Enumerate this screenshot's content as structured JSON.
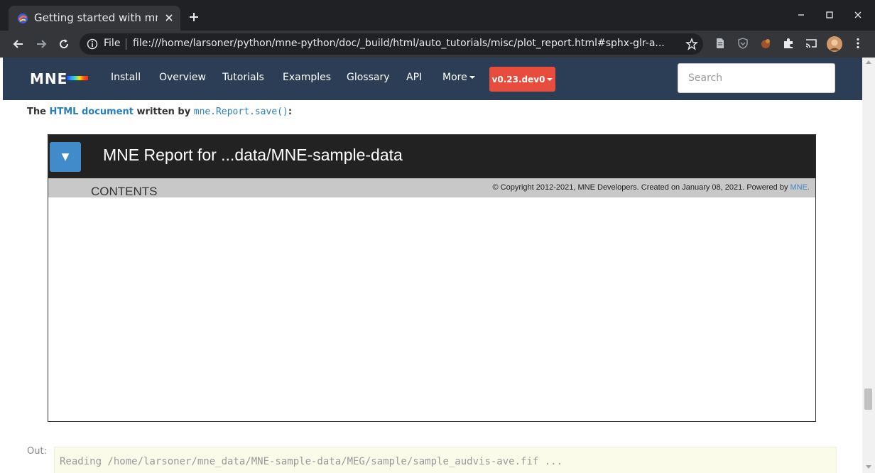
{
  "browser": {
    "tab_title": "Getting started with mne.Report",
    "omnibox_scheme": "File",
    "url": "file:///home/larsoner/python/mne-python/doc/_build/html/auto_tutorials/misc/plot_report.html#sphx-glr-a..."
  },
  "navbar": {
    "logo": "MNE",
    "links": [
      "Install",
      "Overview",
      "Tutorials",
      "Examples",
      "Glossary",
      "API",
      "More"
    ],
    "version": "v0.23.dev0",
    "search_placeholder": "Search"
  },
  "content": {
    "intro_the": "The ",
    "intro_link": "HTML document",
    "intro_written": " written by ",
    "intro_code": "mne.Report.save()",
    "intro_colon": ":"
  },
  "report": {
    "toggle_symbol": "▼",
    "title": "MNE Report for ...data/MNE-sample-data",
    "contents_label": "CONTENTS",
    "copyright": "© Copyright 2012-2021, MNE Developers. Created on January 08, 2021. Powered by ",
    "powered_link": "MNE."
  },
  "output": {
    "label": "Out:",
    "text": "Reading /home/larsoner/mne_data/MNE-sample-data/MEG/sample/sample_audvis-ave.fif ..."
  },
  "colors": {
    "navbar_bg": "#2c3e56",
    "version_button": "#e74c3c",
    "link": "#2980b9",
    "report_header": "#222222",
    "toggle_button": "#428bca"
  }
}
